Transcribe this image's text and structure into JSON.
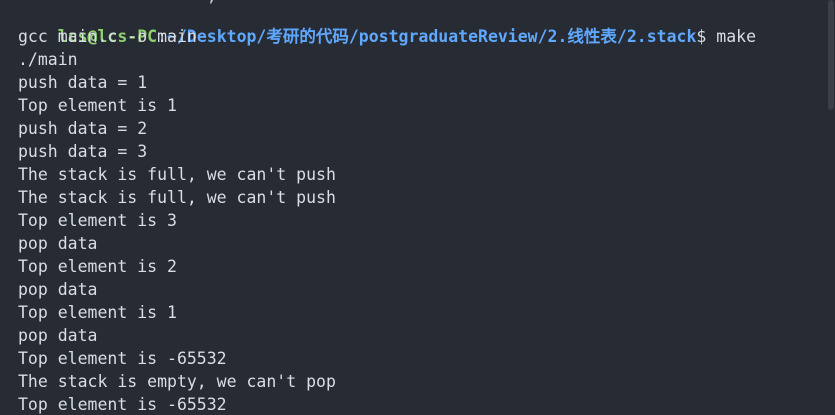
{
  "prompt": {
    "user_host": "lcs@lcs-PC",
    "separator": ":",
    "path": "~/Desktop/考研的代码/postgraduateReview/2.线性表/2.stack",
    "dollar": "$",
    "command": " make"
  },
  "partial_top_line": "  ` '  '    \" `  \" , \"` `     ",
  "output_lines": [
    "gcc main.c -o main",
    "./main",
    "push data = 1",
    "Top element is 1",
    "push data = 2",
    "push data = 3",
    "The stack is full, we can't push",
    "The stack is full, we can't push",
    "Top element is 3",
    "pop data",
    "Top element is 2",
    "pop data",
    "Top element is 1",
    "pop data",
    "Top element is -65532",
    "The stack is empty, we can't pop",
    "Top element is -65532"
  ],
  "colors": {
    "background": "#272b33",
    "text": "#d8dde6",
    "user_host": "#8fd16f",
    "path": "#5fa8ff"
  }
}
